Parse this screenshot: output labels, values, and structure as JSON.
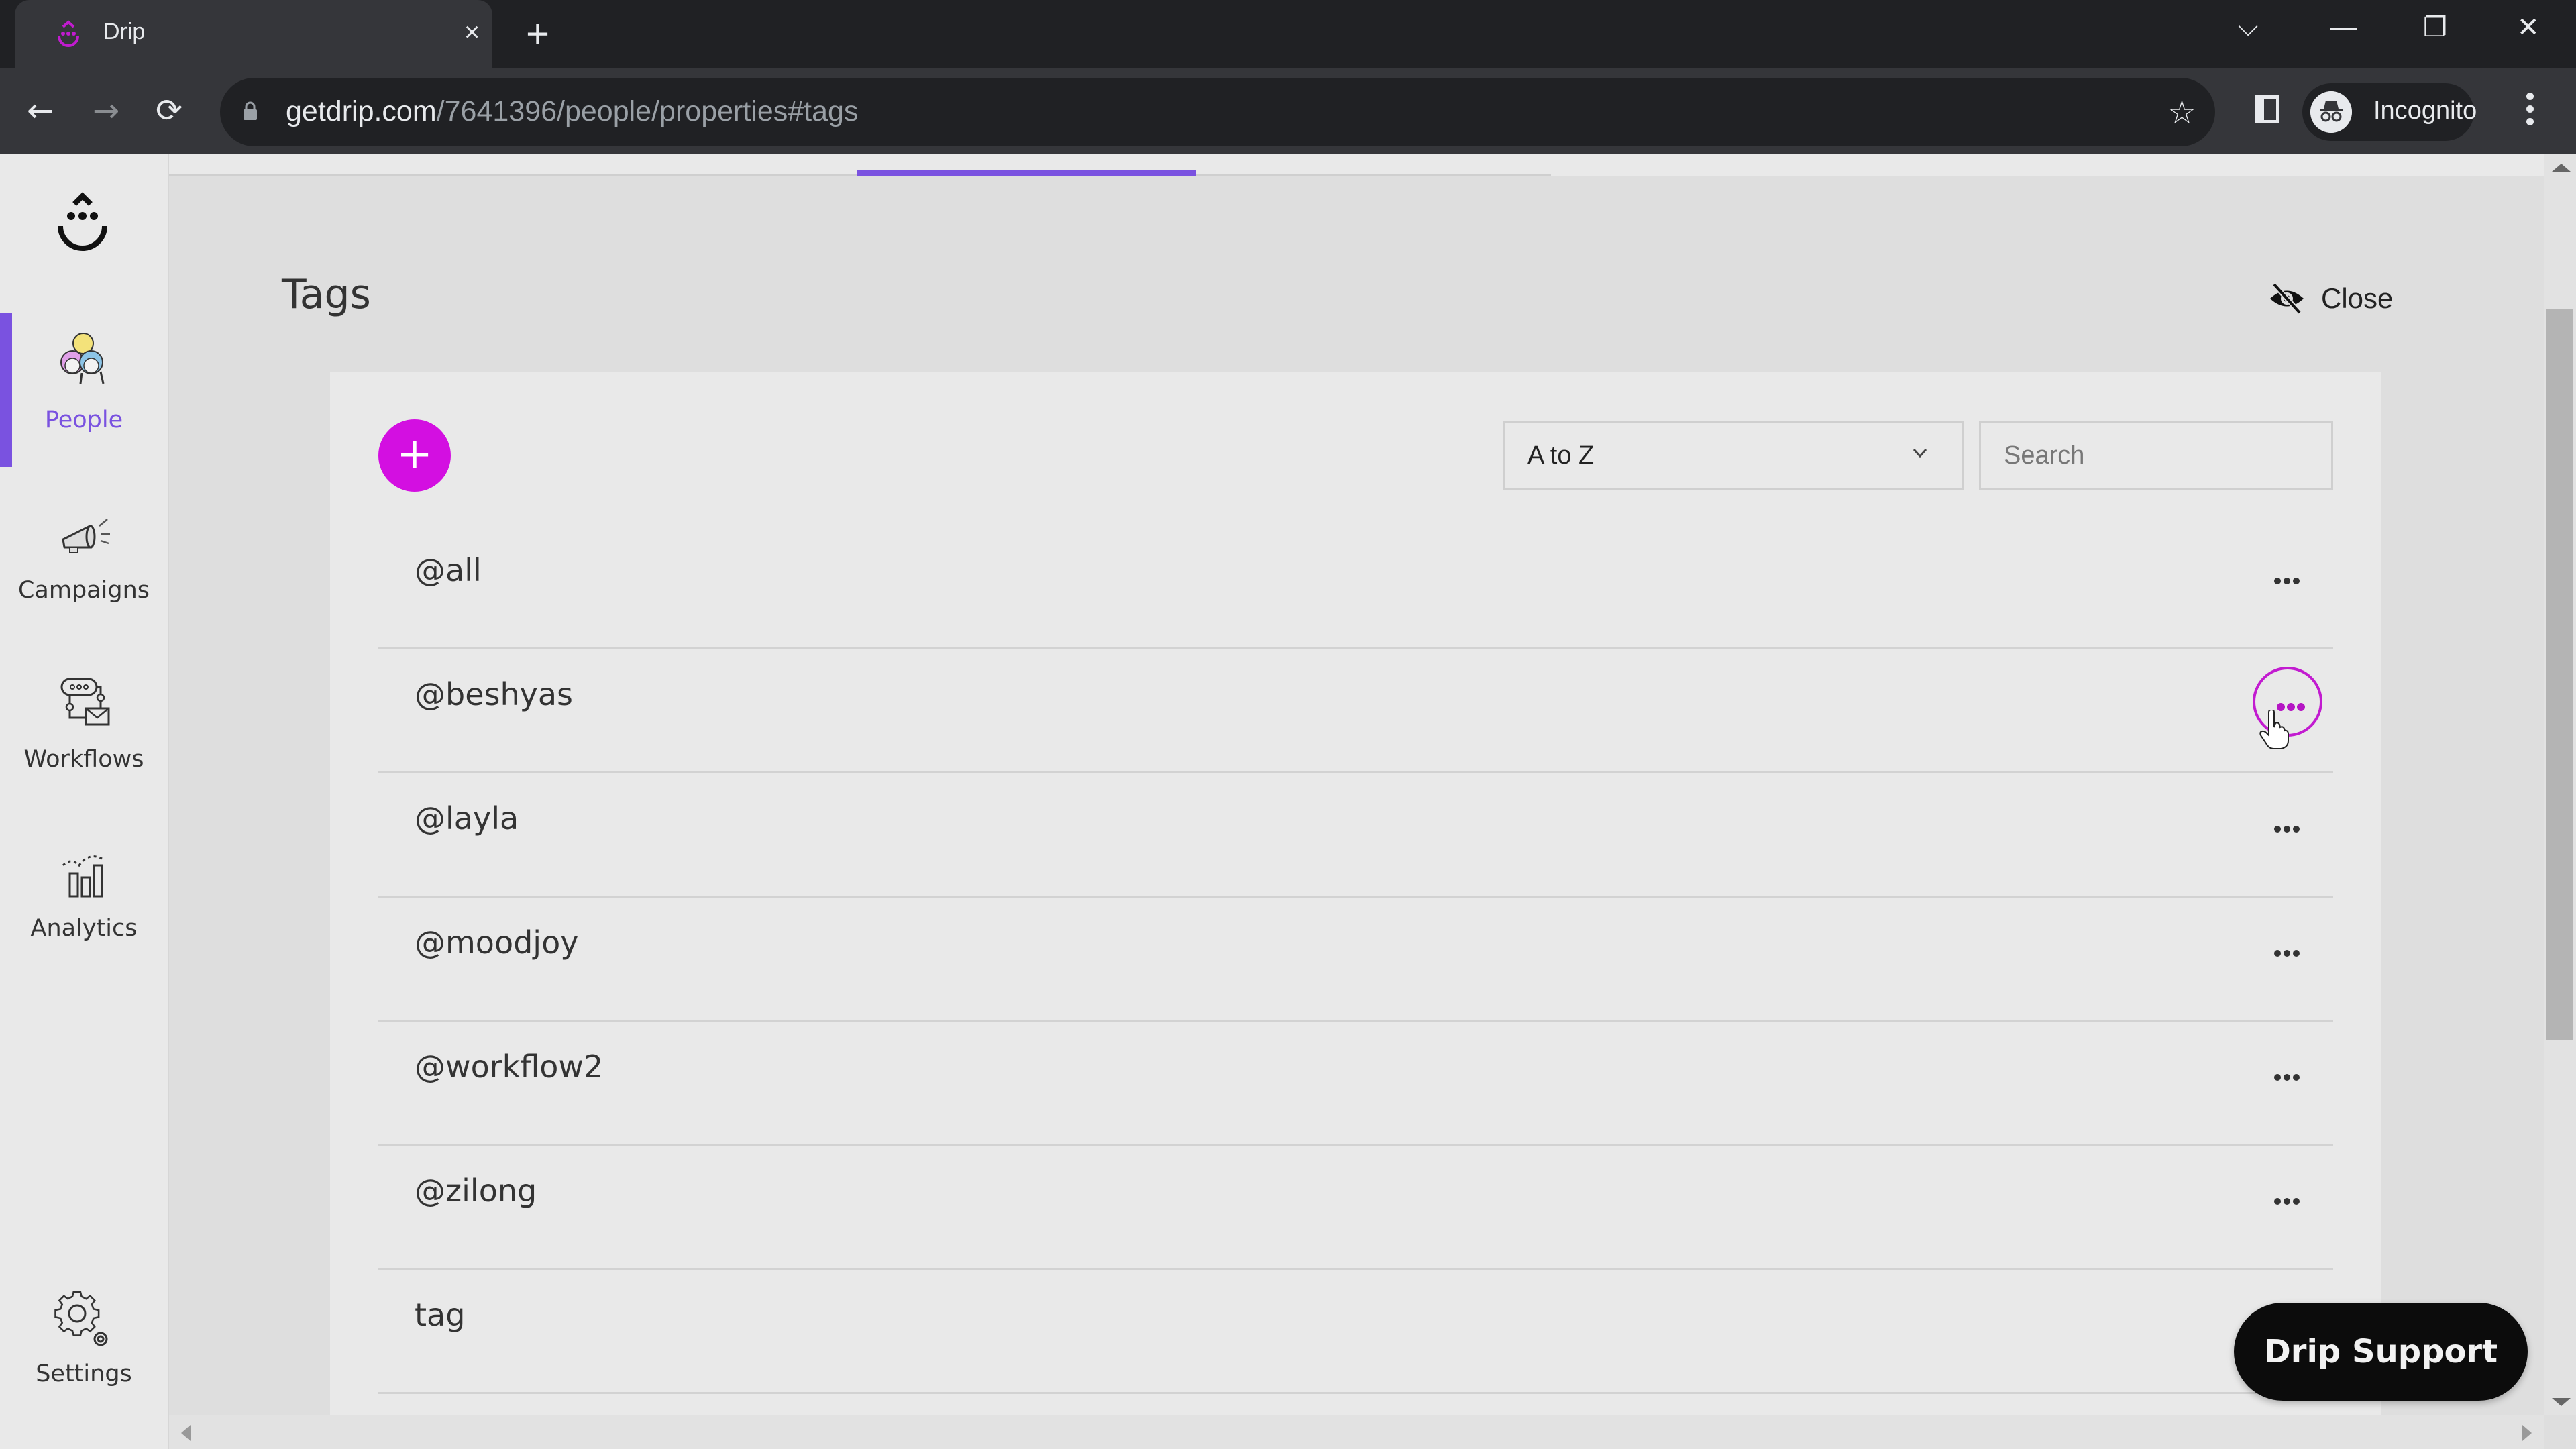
{
  "browser": {
    "tab_title": "Drip",
    "tab_close": "×",
    "new_tab": "+",
    "url_host": "getdrip.com",
    "url_path": "/7641396/people/properties#tags",
    "profile_label": "Incognito",
    "window_controls": {
      "tab_search": "⌵",
      "minimize": "—",
      "restore": "❐",
      "close": "✕"
    },
    "nav": {
      "back": "←",
      "forward": "→",
      "reload": "⟳",
      "star": "☆"
    }
  },
  "sidebar": {
    "items": [
      {
        "label": "People",
        "icon": "people-icon",
        "active": true
      },
      {
        "label": "Campaigns",
        "icon": "megaphone-icon",
        "active": false
      },
      {
        "label": "Workflows",
        "icon": "workflow-icon",
        "active": false
      },
      {
        "label": "Analytics",
        "icon": "analytics-icon",
        "active": false
      },
      {
        "label": "Settings",
        "icon": "gear-icon",
        "active": false
      }
    ]
  },
  "page": {
    "title": "Tags",
    "close_label": "Close",
    "add_label": "+",
    "sort": {
      "selected": "A to Z"
    },
    "search": {
      "placeholder": "Search",
      "value": ""
    },
    "tags": [
      {
        "name": "@all",
        "menu_hover": false
      },
      {
        "name": "@beshyas",
        "menu_hover": true
      },
      {
        "name": "@layla",
        "menu_hover": false
      },
      {
        "name": "@moodjoy",
        "menu_hover": false
      },
      {
        "name": "@workflow2",
        "menu_hover": false
      },
      {
        "name": "@zilong",
        "menu_hover": false
      },
      {
        "name": "tag",
        "menu_hover": false
      }
    ]
  },
  "support_button": "Drip Support",
  "colors": {
    "accent_purple": "#7a52e0",
    "brand_magenta": "#d30fe1",
    "support_bg": "#0c0c0c"
  }
}
